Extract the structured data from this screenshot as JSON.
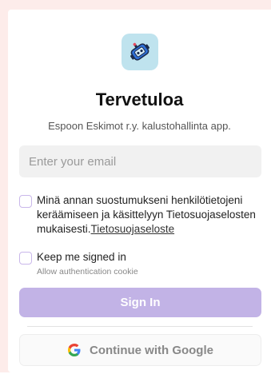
{
  "app": {
    "logo_icon": "robot-icon",
    "title": "Tervetuloa",
    "subtitle": "Espoon Eskimot r.y. kalustohallinta app."
  },
  "form": {
    "email_placeholder": "Enter your email",
    "email_value": "",
    "consent_text": "Minä annan suostumukseni henkilötietojeni keräämiseen ja käsittelyyn Tietosuojaselosten mukaisesti.",
    "consent_link": "Tietosuojaseloste",
    "consent_checked": false,
    "keep_signed_in_label": "Keep me signed in",
    "keep_signed_in_hint": "Allow authentication cookie",
    "keep_signed_in_checked": false,
    "signin_label": "Sign In",
    "google_label": "Continue with Google",
    "google_icon": "google-g-icon"
  },
  "colors": {
    "page_background": "#fdecea",
    "primary_button": "#c2b3e6",
    "checkbox_border": "#c9b7ea",
    "logo_background": "#bfe3ee"
  }
}
